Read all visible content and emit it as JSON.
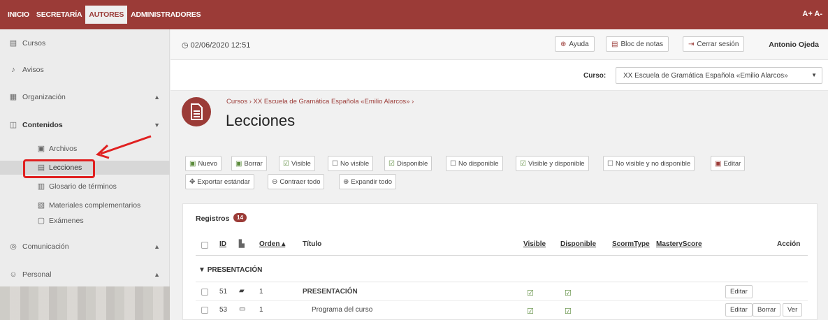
{
  "topnav": {
    "items": [
      {
        "label": "INICIO"
      },
      {
        "label": "SECRETARÍA"
      },
      {
        "label": "AUTORES"
      },
      {
        "label": "ADMINISTRADORES"
      }
    ],
    "active": "AUTORES",
    "font_size_label": "A+ A-"
  },
  "sidebar": {
    "items": [
      {
        "label": "Cursos",
        "icon": "book-icon"
      },
      {
        "label": "Avisos",
        "icon": "bell-icon"
      },
      {
        "label": "Organización",
        "icon": "building-icon",
        "arrow": "▲"
      },
      {
        "label": "Contenidos",
        "icon": "book-open-icon",
        "arrow": "▼"
      },
      {
        "label": "Comunicación",
        "icon": "chat-icon",
        "arrow": "▲"
      },
      {
        "label": "Personal",
        "icon": "users-icon",
        "arrow": "▲"
      }
    ],
    "subitems": [
      {
        "label": "Archivos",
        "icon": "folder-icon"
      },
      {
        "label": "Lecciones",
        "icon": "doc-icon"
      },
      {
        "label": "Glosario de términos",
        "icon": "glossary-icon"
      },
      {
        "label": "Materiales complementarios",
        "icon": "materials-icon"
      },
      {
        "label": "Exámenes",
        "icon": "exam-icon"
      }
    ]
  },
  "header": {
    "datetime": "02/06/2020 12:51",
    "help_label": "Ayuda",
    "notes_label": "Bloc de notas",
    "logout_label": "Cerrar sesión",
    "user": "Antonio Ojeda",
    "course_label": "Curso:",
    "course_value": "XX Escuela de Gramática Española «Emilio Alarcos»"
  },
  "page": {
    "breadcrumb": "Cursos › XX Escuela de Gramática Española «Emilio Alarcos» ›",
    "title": "Lecciones"
  },
  "toolbar": {
    "buttons": [
      "Nuevo",
      "Borrar",
      "Visible",
      "No visible",
      "Disponible",
      "No disponible",
      "Visible y disponible",
      "No visible y no disponible",
      "Editar",
      "Exportar estándar",
      "Contraer todo",
      "Expandir todo"
    ]
  },
  "table": {
    "title": "Registros",
    "count": "14",
    "columns": [
      "ID",
      "Orden ▴",
      "Título",
      "Visible",
      "Disponible",
      "ScormType",
      "MasteryScore",
      "Acción"
    ],
    "group": "PRESENTACIÓN",
    "rows": [
      {
        "id": "51",
        "orden": "1",
        "titulo": "PRESENTACIÓN",
        "actions": [
          "Editar"
        ]
      },
      {
        "id": "53",
        "orden": "1",
        "titulo": "Programa del curso",
        "actions": [
          "Editar",
          "Borrar",
          "Ver"
        ]
      }
    ]
  }
}
